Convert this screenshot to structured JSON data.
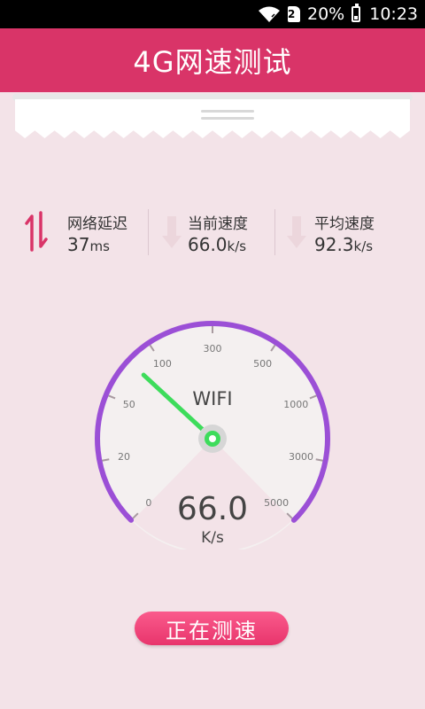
{
  "status_bar": {
    "sim_label": "2",
    "battery": "20%",
    "time": "10:23"
  },
  "header": {
    "title": "4G网速测试"
  },
  "stats": {
    "latency": {
      "label": "网络延迟",
      "value": "37",
      "unit": "ms"
    },
    "current": {
      "label": "当前速度",
      "value": "66.0",
      "unit": "k/s"
    },
    "average": {
      "label": "平均速度",
      "value": "92.3",
      "unit": "k/s"
    }
  },
  "gauge": {
    "network_label": "WIFI",
    "speed": "66.0",
    "unit": "K/s",
    "scale_labels": [
      "0",
      "20",
      "50",
      "100",
      "300",
      "500",
      "1000",
      "3000",
      "5000"
    ],
    "needle_value_index": 2.6,
    "arc_color": "#9b4fd6",
    "needle_color": "#3ddc5b"
  },
  "button": {
    "label": "正在测速"
  },
  "colors": {
    "accent": "#d93468",
    "background": "#f3e3e8"
  }
}
